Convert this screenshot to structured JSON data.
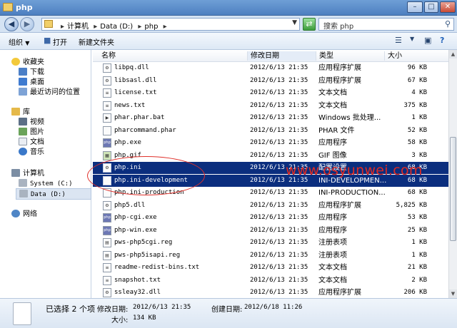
{
  "window": {
    "title": "php",
    "min": "–",
    "max": "□",
    "close": "✕"
  },
  "address": {
    "crumbs": [
      "计算机",
      "Data (D:)",
      "php"
    ],
    "search_placeholder": "搜索 php"
  },
  "toolbar": {
    "organize": "组织",
    "open": "打开",
    "new_folder": "新建文件夹"
  },
  "nav": {
    "favorites": "收藏夹",
    "downloads": "下载",
    "desktop": "桌面",
    "recent": "最近访问的位置",
    "libraries": "库",
    "videos": "视频",
    "pictures": "图片",
    "documents": "文档",
    "music": "音乐",
    "computer": "计算机",
    "drive_c": "System (C:)",
    "drive_d": "Data (D:)",
    "network": "网络"
  },
  "columns": {
    "name": "名称",
    "date": "修改日期",
    "type": "类型",
    "size": "大小"
  },
  "files": [
    {
      "name": "libpq.dll",
      "date": "2012/6/13 21:35",
      "type": "应用程序扩展",
      "size": "96 KB",
      "icon": "dll",
      "selected": false
    },
    {
      "name": "libsasl.dll",
      "date": "2012/6/13 21:35",
      "type": "应用程序扩展",
      "size": "67 KB",
      "icon": "dll",
      "selected": false
    },
    {
      "name": "license.txt",
      "date": "2012/6/13 21:35",
      "type": "文本文档",
      "size": "4 KB",
      "icon": "txt",
      "selected": false
    },
    {
      "name": "news.txt",
      "date": "2012/6/13 21:35",
      "type": "文本文档",
      "size": "375 KB",
      "icon": "txt",
      "selected": false
    },
    {
      "name": "phar.phar.bat",
      "date": "2012/6/13 21:35",
      "type": "Windows 批处理...",
      "size": "1 KB",
      "icon": "bat",
      "selected": false
    },
    {
      "name": "pharcommand.phar",
      "date": "2012/6/13 21:35",
      "type": "PHAR 文件",
      "size": "52 KB",
      "icon": "file",
      "selected": false
    },
    {
      "name": "php.exe",
      "date": "2012/6/13 21:35",
      "type": "应用程序",
      "size": "58 KB",
      "icon": "php",
      "selected": false
    },
    {
      "name": "php.gif",
      "date": "2012/6/13 21:35",
      "type": "GIF 图像",
      "size": "3 KB",
      "icon": "gif",
      "selected": false
    },
    {
      "name": "php.ini",
      "date": "2012/6/13 21:35",
      "type": "配置设置",
      "size": "68 KB",
      "icon": "ini",
      "selected": true
    },
    {
      "name": "php.ini-development",
      "date": "2012/6/13 21:35",
      "type": "INI-DEVELOPMEN...",
      "size": "68 KB",
      "icon": "file",
      "selected": true
    },
    {
      "name": "php.ini-production",
      "date": "2012/6/13 21:35",
      "type": "INI-PRODUCTION...",
      "size": "68 KB",
      "icon": "file",
      "selected": false
    },
    {
      "name": "php5.dll",
      "date": "2012/6/13 21:35",
      "type": "应用程序扩展",
      "size": "5,825 KB",
      "icon": "dll",
      "selected": false
    },
    {
      "name": "php-cgi.exe",
      "date": "2012/6/13 21:35",
      "type": "应用程序",
      "size": "53 KB",
      "icon": "php",
      "selected": false
    },
    {
      "name": "php-win.exe",
      "date": "2012/6/13 21:35",
      "type": "应用程序",
      "size": "25 KB",
      "icon": "php",
      "selected": false
    },
    {
      "name": "pws-php5cgi.reg",
      "date": "2012/6/13 21:35",
      "type": "注册表项",
      "size": "1 KB",
      "icon": "reg",
      "selected": false
    },
    {
      "name": "pws-php5isapi.reg",
      "date": "2012/6/13 21:35",
      "type": "注册表项",
      "size": "1 KB",
      "icon": "reg",
      "selected": false
    },
    {
      "name": "readme-redist-bins.txt",
      "date": "2012/6/13 21:35",
      "type": "文本文档",
      "size": "21 KB",
      "icon": "txt",
      "selected": false
    },
    {
      "name": "snapshot.txt",
      "date": "2012/6/13 21:35",
      "type": "文本文档",
      "size": "2 KB",
      "icon": "txt",
      "selected": false
    },
    {
      "name": "ssleay32.dll",
      "date": "2012/6/13 21:35",
      "type": "应用程序扩展",
      "size": "206 KB",
      "icon": "dll",
      "selected": false
    }
  ],
  "watermark": "www.osyunwei.com",
  "details": {
    "selected": "已选择 2 个项",
    "modified_label": "修改日期:",
    "modified": "2012/6/13 21:35",
    "created_label": "创建日期:",
    "created": "2012/6/18 11:26",
    "size_label": "大小:",
    "size": "134 KB"
  },
  "scroll": {
    "position": 0.62,
    "visible_fraction": 0.45
  }
}
